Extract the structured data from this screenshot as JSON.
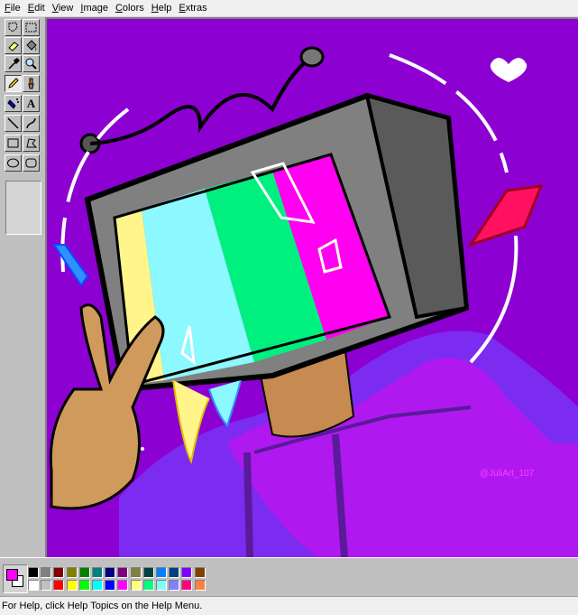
{
  "menu": [
    "File",
    "Edit",
    "View",
    "Image",
    "Colors",
    "Help",
    "Extras"
  ],
  "tools": [
    {
      "name": "free-select-icon"
    },
    {
      "name": "rect-select-icon"
    },
    {
      "name": "eraser-icon"
    },
    {
      "name": "fill-bucket-icon"
    },
    {
      "name": "color-picker-icon"
    },
    {
      "name": "magnifier-icon"
    },
    {
      "name": "pencil-icon",
      "active": true
    },
    {
      "name": "brush-icon"
    },
    {
      "name": "airbrush-icon"
    },
    {
      "name": "text-icon",
      "glyph": "A"
    },
    {
      "name": "line-icon"
    },
    {
      "name": "curve-icon"
    },
    {
      "name": "rectangle-icon"
    },
    {
      "name": "polygon-icon"
    },
    {
      "name": "ellipse-icon"
    },
    {
      "name": "rounded-rect-icon"
    }
  ],
  "canvas": {
    "watermark": "@JuliArt_107"
  },
  "colors": {
    "foreground": "#ff00ff",
    "background": "#ffffff",
    "palette_top": [
      "#000000",
      "#808080",
      "#800000",
      "#808000",
      "#008000",
      "#008080",
      "#000080",
      "#800080",
      "#808040",
      "#004040",
      "#0080ff",
      "#004080",
      "#8000ff",
      "#804000"
    ],
    "palette_bottom": [
      "#ffffff",
      "#c0c0c0",
      "#ff0000",
      "#ffff00",
      "#00ff00",
      "#00ffff",
      "#0000ff",
      "#ff00ff",
      "#ffff80",
      "#00ff80",
      "#80ffff",
      "#8080ff",
      "#ff0080",
      "#ff8040"
    ]
  },
  "status": {
    "text": "For Help, click Help Topics on the Help Menu."
  }
}
